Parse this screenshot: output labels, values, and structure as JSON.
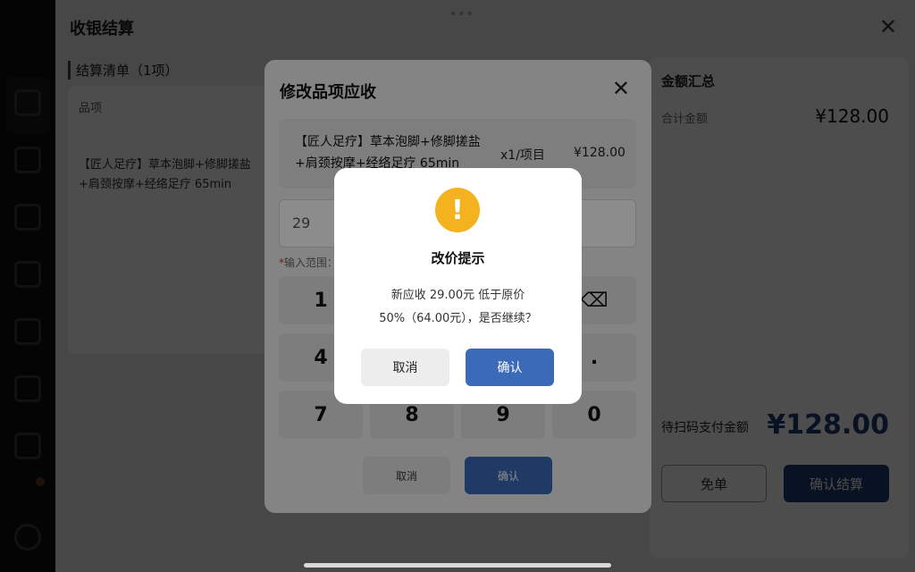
{
  "header": {
    "title": "收银结算",
    "close_glyph": "✕",
    "grabber": "•••"
  },
  "checklist": {
    "title": "结算清单（1项）",
    "column_header": "品项",
    "item_name": "【匠人足疗】草本泡脚+修脚搓盐+肩颈按摩+经络足疗 65min"
  },
  "summary": {
    "title": "金额汇总",
    "total_label": "合计金额",
    "total_value": "¥128.00",
    "pay_label": "待扫码支付金额",
    "pay_value": "¥128.00",
    "free_label": "免单",
    "settle_label": "确认结算"
  },
  "edit_modal": {
    "title": "修改品项应收",
    "close_glyph": "✕",
    "item_name": "【匠人足疗】草本泡脚+修脚搓盐+肩颈按摩+经络足疗 65min",
    "item_qty": "x1/项目",
    "item_price": "¥128.00",
    "input_value": "29",
    "range_star": "*",
    "range_hint": "输入范围：",
    "keys": [
      "1",
      "⌫",
      "4",
      ".",
      "7",
      "8",
      "9",
      "0"
    ],
    "cancel_label": "取消",
    "confirm_label": "确认"
  },
  "alert": {
    "icon_glyph": "!",
    "title": "改价提示",
    "message_line1": "新应收 29.00元 低于原价",
    "message_line2": "50%（64.00元），是否继续？",
    "cancel_label": "取消",
    "confirm_label": "确认"
  },
  "colors": {
    "accent": "#3a6ab8",
    "warning": "#f5b21f",
    "navy": "#1d3c73"
  }
}
